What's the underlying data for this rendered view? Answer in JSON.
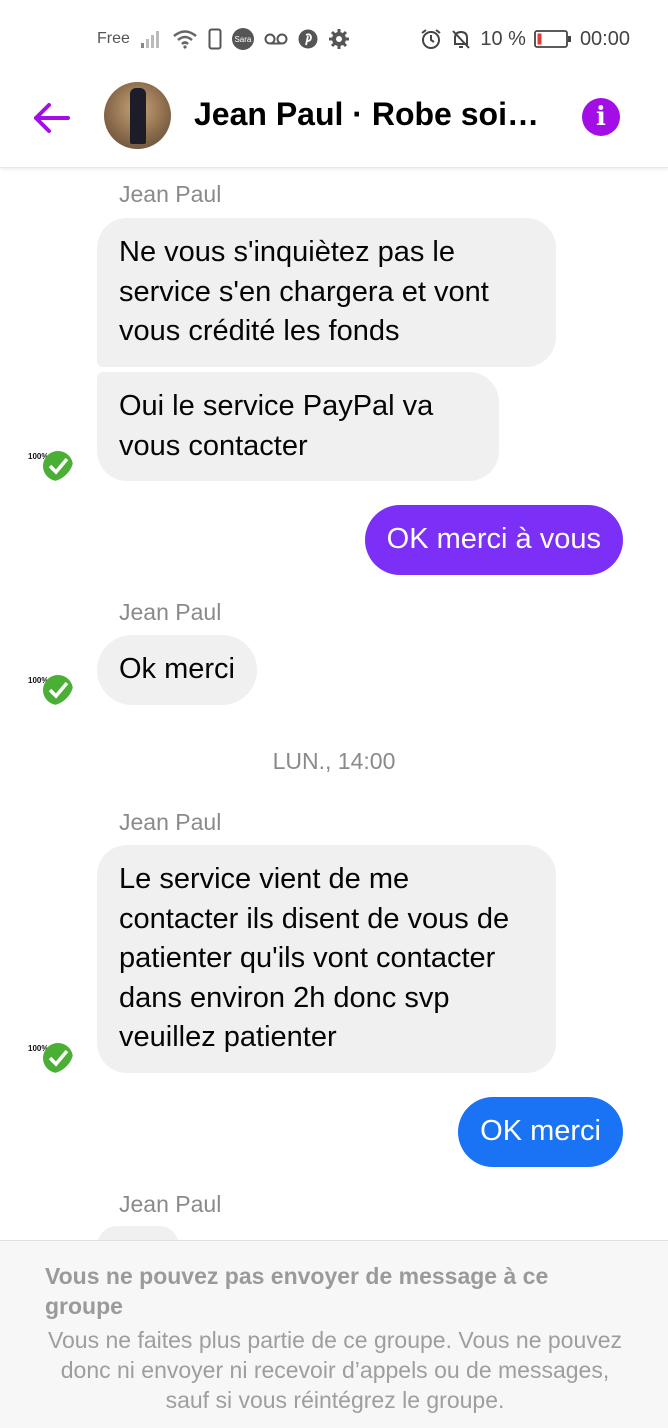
{
  "status_bar": {
    "carrier": "Free",
    "battery_text": "10 %",
    "time": "00:00",
    "icons": [
      "signal-icon",
      "wifi-icon",
      "phone-icon",
      "sara-icon",
      "voicemail-icon",
      "pinterest-icon",
      "settings-icon",
      "alarm-icon",
      "bell-off-icon",
      "battery-icon"
    ],
    "sara_label": "Sara"
  },
  "header": {
    "title": "Jean Paul · Robe soirée",
    "info_label": "i",
    "accent_color": "#a40ee6"
  },
  "messages": [
    {
      "type": "sender",
      "text": "Jean Paul"
    },
    {
      "type": "in",
      "text": "Ne vous s'inquiètez pas le service s'en chargera et vont vous crédité les fonds"
    },
    {
      "type": "in",
      "text": "Oui le service PayPal va vous contacter"
    },
    {
      "type": "out",
      "text": "OK merci à vous",
      "color": "#7b2ff7"
    },
    {
      "type": "sender",
      "text": "Jean Paul"
    },
    {
      "type": "in",
      "text": "Ok merci"
    },
    {
      "type": "timestamp",
      "text": "LUN., 14:00"
    },
    {
      "type": "sender",
      "text": "Jean Paul"
    },
    {
      "type": "in",
      "text": "Le service vient de me contacter ils disent de vous de patienter qu'ils vont contacter dans environ 2h donc svp veuillez patienter"
    },
    {
      "type": "out",
      "text": "OK merci",
      "color": "#1a73f5"
    },
    {
      "type": "sender",
      "text": "Jean Paul"
    }
  ],
  "avatar_badge": "100%",
  "footer": {
    "title": "Vous ne pouvez pas envoyer de message à ce groupe",
    "body": "Vous ne faites plus partie de ce groupe. Vous ne pouvez donc ni envoyer ni recevoir d’appels ou de messages, sauf si vous réintégrez le groupe."
  }
}
